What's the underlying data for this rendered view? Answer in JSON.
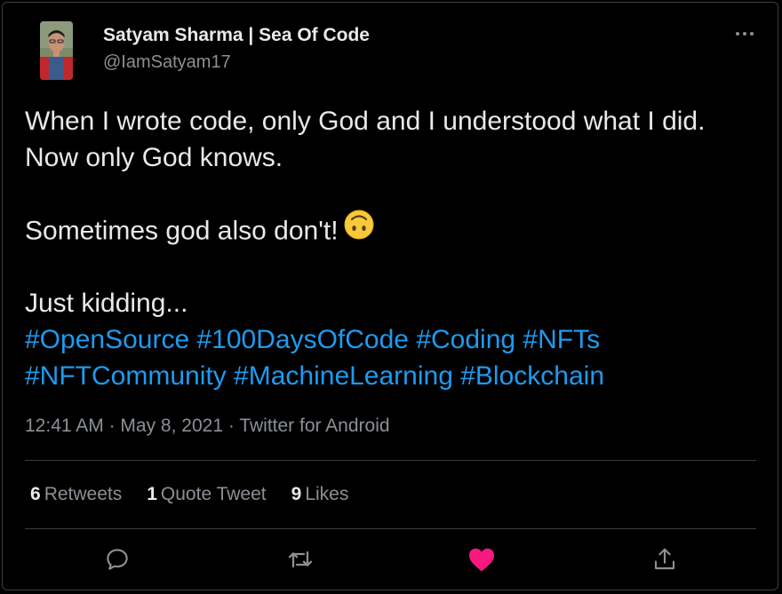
{
  "author": {
    "display_name": "Satyam Sharma | Sea Of Code",
    "handle": "@IamSatyam17"
  },
  "tweet": {
    "lines": [
      "When I wrote code, only God and I understood what I did.",
      "Now only God knows.",
      "Sometimes god also don't!",
      "Just kidding..."
    ],
    "emoji": "upside-down-face",
    "hashtags_line1": [
      "#OpenSource",
      "#100DaysOfCode",
      "#Coding",
      "#NFTs"
    ],
    "hashtags_line2": [
      "#NFTCommunity",
      "#MachineLearning",
      "#Blockchain"
    ]
  },
  "meta": {
    "time": "12:41 AM",
    "date": "May 8, 2021",
    "source": "Twitter for Android",
    "separator": "·"
  },
  "stats": {
    "retweets_count": "6",
    "retweets_label": "Retweets",
    "quotes_count": "1",
    "quotes_label": "Quote Tweet",
    "likes_count": "9",
    "likes_label": "Likes"
  },
  "actions": {
    "icons": [
      "reply-icon",
      "retweet-icon",
      "like-icon",
      "share-icon"
    ],
    "like_color": "#f91880",
    "icon_color": "#8b9096"
  },
  "colors": {
    "background": "#000000",
    "text": "#e7e9ea",
    "secondary_text": "#8b9096",
    "link": "#1d9bf0",
    "border": "#3a3d40"
  }
}
